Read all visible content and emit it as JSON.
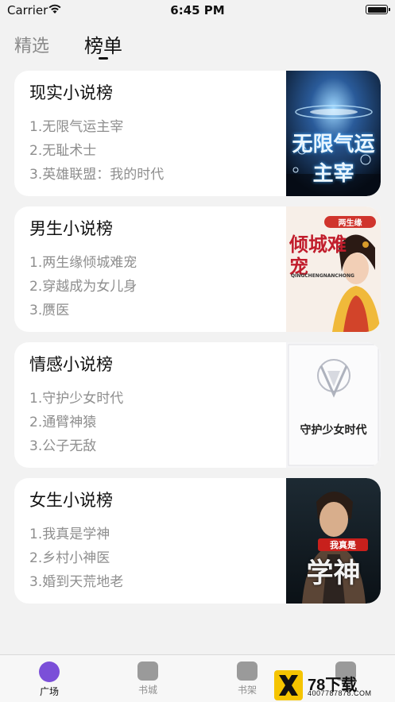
{
  "status_bar": {
    "carrier": "Carrier",
    "time": "6:45 PM"
  },
  "top_tabs": [
    {
      "label": "精选",
      "active": false
    },
    {
      "label": "榜单",
      "active": true
    }
  ],
  "cards": [
    {
      "title": "现实小说榜",
      "items": [
        "1.无限气运主宰",
        "2.无耻术士",
        "3.英雄联盟：我的时代"
      ],
      "cover": {
        "text": "无限气运主宰",
        "style": "space"
      }
    },
    {
      "title": "男生小说榜",
      "items": [
        "1.两生缘倾城难宠",
        "2.穿越成为女儿身",
        "3.赝医"
      ],
      "cover": {
        "text": "倾城难宠",
        "sub": "两生缘",
        "latin": "QINGCHENGNANCHONG",
        "style": "romance"
      }
    },
    {
      "title": "情感小说榜",
      "items": [
        "1.守护少女时代",
        "2.通臂神猿",
        "3.公子无敌"
      ],
      "cover": {
        "text": "守护少女时代",
        "style": "plain"
      }
    },
    {
      "title": "女生小说榜",
      "items": [
        "1.我真是学神",
        "2.乡村小神医",
        "3.婚到天荒地老"
      ],
      "cover": {
        "text": "学神",
        "sub": "我真是",
        "style": "hero"
      }
    }
  ],
  "tab_bar": [
    {
      "label": "广场",
      "active": true,
      "icon": "planet-icon"
    },
    {
      "label": "书城",
      "active": false,
      "icon": "bookstore-icon"
    },
    {
      "label": "书架",
      "active": false,
      "icon": "bookshelf-icon"
    }
  ],
  "watermark": {
    "brand": "78下载",
    "url": "4007787878.COM"
  },
  "colors": {
    "background": "#f2f2f2",
    "card": "#ffffff",
    "muted_text": "#8e8e8e",
    "accent": "#7b4fd8",
    "watermark_yellow": "#f5c400"
  }
}
